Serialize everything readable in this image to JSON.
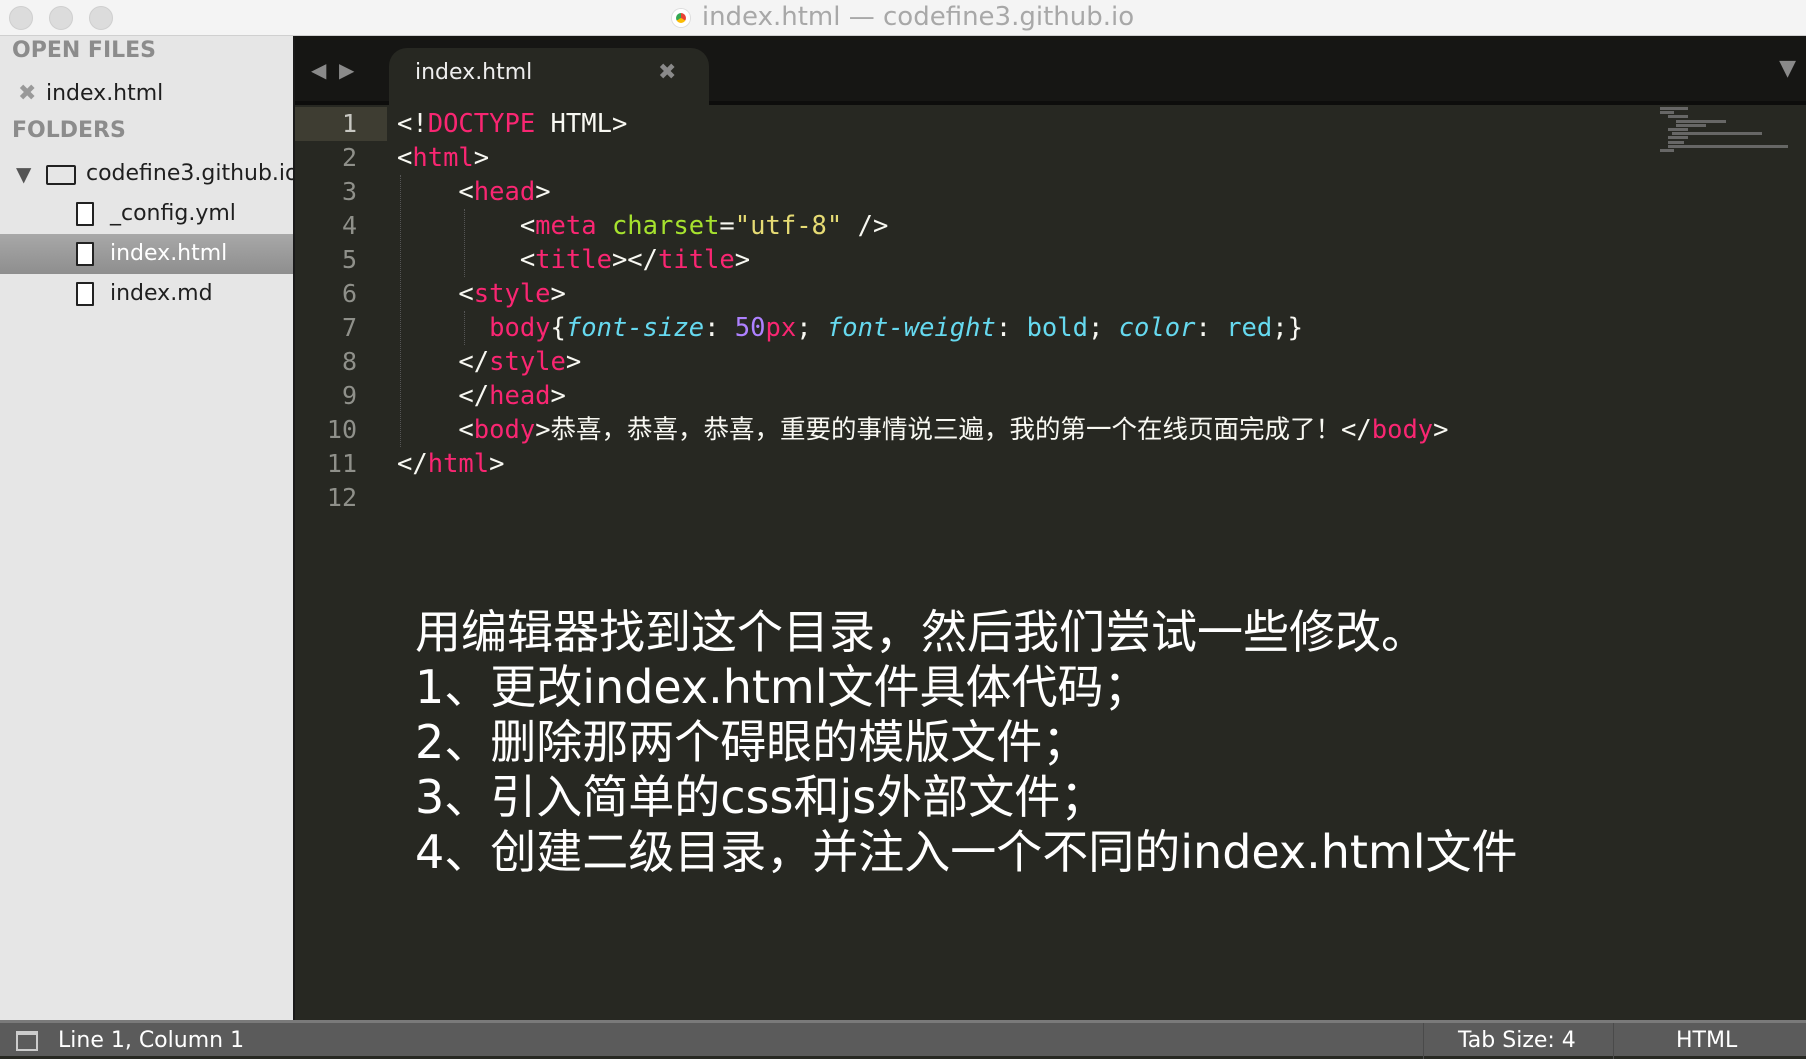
{
  "window": {
    "title": "index.html — codefine3.github.io"
  },
  "sidebar": {
    "open_files_label": "OPEN FILES",
    "open_files": [
      {
        "name": "index.html"
      }
    ],
    "folders_label": "FOLDERS",
    "folder": {
      "name": "codefine3.github.io",
      "files": [
        {
          "name": "_config.yml"
        },
        {
          "name": "index.html",
          "selected": true
        },
        {
          "name": "index.md"
        }
      ]
    }
  },
  "tabs": [
    {
      "label": "index.html",
      "active": true
    }
  ],
  "editor": {
    "line_numbers": [
      "1",
      "2",
      "3",
      "4",
      "5",
      "6",
      "7",
      "8",
      "9",
      "10",
      "11",
      "12"
    ],
    "current_line": 1
  },
  "notes": [
    "用编辑器找到这个目录，然后我们尝试一些修改。",
    "1、更改index.html文件具体代码；",
    "2、删除那两个碍眼的模版文件；",
    "3、引入简单的css和js外部文件；",
    "4、创建二级目录，并注入一个不同的index.html文件"
  ],
  "status": {
    "position": "Line 1, Column 1",
    "tab_size": "Tab Size: 4",
    "syntax": "HTML"
  },
  "colors": {
    "tag": "#f92672",
    "attr": "#a6e22e",
    "string": "#e6db74",
    "property": "#66d9ef",
    "number": "#ae81ff",
    "editor_bg": "#272822"
  }
}
